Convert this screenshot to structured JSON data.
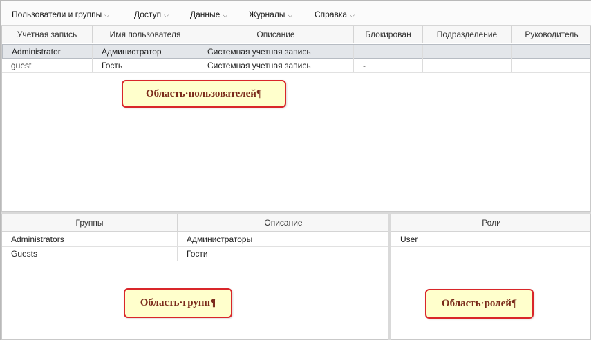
{
  "menu": {
    "items": [
      {
        "label": "Пользователи и группы",
        "chevron": "⌵"
      },
      {
        "label": "Доступ",
        "chevron": "⌵"
      },
      {
        "label": "Данные",
        "chevron": "⌵"
      },
      {
        "label": "Журналы",
        "chevron": "⌵"
      },
      {
        "label": "Справка",
        "chevron": "⌵"
      }
    ]
  },
  "users": {
    "columns": [
      "Учетная запись",
      "Имя пользователя",
      "Описание",
      "Блокирован",
      "Подразделение",
      "Руководитель"
    ],
    "rows": [
      {
        "account": "Administrator",
        "name": "Администратор",
        "description": "Системная учетная запись",
        "blocked": "",
        "department": "",
        "manager": "",
        "selected": true
      },
      {
        "account": "guest",
        "name": "Гость",
        "description": "Системная учетная запись",
        "blocked": "-",
        "department": "",
        "manager": "",
        "selected": false
      }
    ],
    "callout": "Область·пользователей¶"
  },
  "groups": {
    "columns": [
      "Группы",
      "Описание"
    ],
    "rows": [
      {
        "group": "Administrators",
        "description": "Администраторы"
      },
      {
        "group": "Guests",
        "description": "Гости"
      }
    ],
    "callout": "Область·групп¶"
  },
  "roles": {
    "columns": [
      "Роли"
    ],
    "rows": [
      {
        "role": "User"
      }
    ],
    "callout": "Область·ролей¶"
  },
  "colors": {
    "callout_border": "#d9262a",
    "callout_bg": "#ffffcc",
    "callout_text": "#7a2a1a",
    "selected_row": "#e3e6ea"
  }
}
